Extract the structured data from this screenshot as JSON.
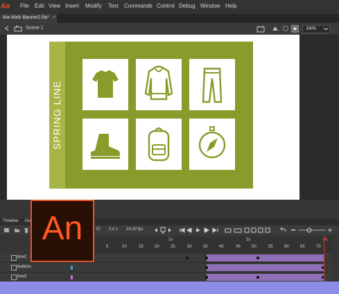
{
  "menu": [
    "File",
    "Edit",
    "View",
    "Insert",
    "Modify",
    "Text",
    "Commands",
    "Control",
    "Debug",
    "Window",
    "Help"
  ],
  "app_logo": "An",
  "document_tab": {
    "title": "Ma-Web Banner2.fla*",
    "close": "×"
  },
  "edit_bar": {
    "scene": "Scene 1",
    "zoom": "64%"
  },
  "banner": {
    "title": "SPRING LINE",
    "background": "#8a9a2b",
    "tiles": [
      "tshirt-icon",
      "hoodie-icon",
      "pants-icon",
      "boot-icon",
      "backpack-icon",
      "compass-icon"
    ]
  },
  "timeline": {
    "tabs": [
      "Timeline",
      "Output"
    ],
    "toolbar": {
      "frame": "72",
      "time": "3.0 s",
      "fps": "24.00 fps"
    },
    "seconds": [
      "1s",
      "2s",
      "3s"
    ],
    "frame_ticks": [
      "5",
      "10",
      "15",
      "20",
      "25",
      "30",
      "35",
      "40",
      "45",
      "50",
      "55",
      "60",
      "65",
      "70"
    ],
    "layers": [
      {
        "name": "box2",
        "color": "#3b9bd8"
      },
      {
        "name": "buttons",
        "color": "#36a6c9"
      },
      {
        "name": "box3",
        "color": "#e266d8"
      }
    ]
  },
  "badge": {
    "label": "An",
    "accent": "#ff5a24"
  }
}
